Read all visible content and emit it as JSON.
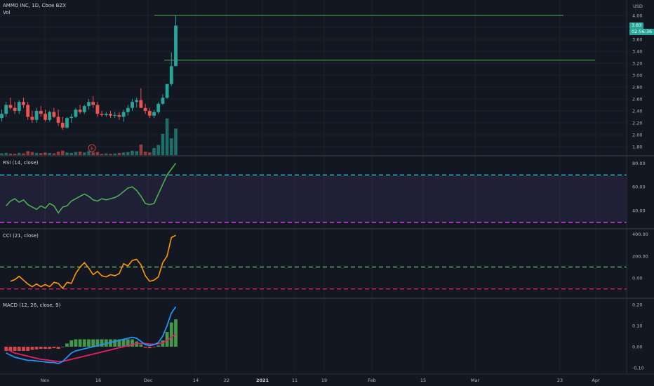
{
  "header": {
    "symbol": "AMMO INC, 1D, Cboe BZX",
    "volume_label": "Vol"
  },
  "price_axis": {
    "currency": "USD",
    "last_price": "3.83",
    "countdown": "02:56:36"
  },
  "colors": {
    "background": "#131722",
    "up": "#26a69a",
    "down": "#ef5350",
    "level_line": "#4caf50",
    "rsi": "#4caf50",
    "rsi_band": "#7e57c2",
    "cci": "#ff9800",
    "macd": "#2196f3",
    "signal": "#e91e63",
    "hist": "#4caf50"
  },
  "chart_data": [
    {
      "type": "candlestick",
      "title": "AMMO INC, 1D, Cboe BZX",
      "x": [
        "Nov",
        "16",
        "Dec",
        "14",
        "22",
        "2021",
        "11",
        "19",
        "Feb",
        "15",
        "Mar",
        "23",
        "Apr"
      ],
      "ylim": [
        1.8,
        4.1
      ],
      "y_ticks": [
        "4.00",
        "3.80",
        "3.60",
        "3.40",
        "3.20",
        "3.00",
        "2.80",
        "2.60",
        "2.40",
        "2.20",
        "2.00",
        "1.80"
      ],
      "horizontal_levels": [
        4.0,
        3.25
      ],
      "candles": [
        [
          2.28,
          2.42,
          2.22,
          2.35
        ],
        [
          2.35,
          2.55,
          2.3,
          2.5
        ],
        [
          2.5,
          2.62,
          2.42,
          2.45
        ],
        [
          2.45,
          2.55,
          2.35,
          2.4
        ],
        [
          2.4,
          2.58,
          2.35,
          2.55
        ],
        [
          2.55,
          2.62,
          2.45,
          2.5
        ],
        [
          2.5,
          2.55,
          2.25,
          2.3
        ],
        [
          2.3,
          2.4,
          2.2,
          2.25
        ],
        [
          2.25,
          2.45,
          2.2,
          2.4
        ],
        [
          2.4,
          2.48,
          2.3,
          2.35
        ],
        [
          2.35,
          2.42,
          2.22,
          2.25
        ],
        [
          2.25,
          2.4,
          2.22,
          2.38
        ],
        [
          2.38,
          2.45,
          2.28,
          2.3
        ],
        [
          2.3,
          2.42,
          2.15,
          2.2
        ],
        [
          2.2,
          2.3,
          2.08,
          2.12
        ],
        [
          2.12,
          2.3,
          2.1,
          2.28
        ],
        [
          2.28,
          2.35,
          2.2,
          2.3
        ],
        [
          2.3,
          2.45,
          2.28,
          2.42
        ],
        [
          2.42,
          2.5,
          2.35,
          2.38
        ],
        [
          2.38,
          2.5,
          2.35,
          2.48
        ],
        [
          2.48,
          2.6,
          2.42,
          2.55
        ],
        [
          2.55,
          2.65,
          2.45,
          2.5
        ],
        [
          2.5,
          2.55,
          2.3,
          2.35
        ],
        [
          2.35,
          2.4,
          2.3,
          2.33
        ],
        [
          2.33,
          2.38,
          2.3,
          2.35
        ],
        [
          2.35,
          2.4,
          2.28,
          2.32
        ],
        [
          2.32,
          2.38,
          2.28,
          2.33
        ],
        [
          2.33,
          2.38,
          2.25,
          2.3
        ],
        [
          2.3,
          2.42,
          2.22,
          2.38
        ],
        [
          2.38,
          2.5,
          2.32,
          2.45
        ],
        [
          2.45,
          2.6,
          2.4,
          2.55
        ],
        [
          2.55,
          2.62,
          2.45,
          2.58
        ],
        [
          2.58,
          2.78,
          2.45,
          2.45
        ],
        [
          2.45,
          2.52,
          2.35,
          2.4
        ],
        [
          2.4,
          2.45,
          2.28,
          2.32
        ],
        [
          2.32,
          2.42,
          2.28,
          2.38
        ],
        [
          2.38,
          2.55,
          2.35,
          2.52
        ],
        [
          2.52,
          2.68,
          2.5,
          2.62
        ],
        [
          2.62,
          2.85,
          2.6,
          2.85
        ],
        [
          2.85,
          3.38,
          2.82,
          3.15
        ],
        [
          3.15,
          4.0,
          3.2,
          3.83
        ]
      ]
    },
    {
      "type": "bar",
      "title": "Vol",
      "values": [
        0.4,
        0.5,
        0.35,
        0.3,
        0.5,
        0.4,
        0.9,
        0.7,
        0.5,
        0.45,
        0.6,
        0.5,
        0.4,
        0.8,
        1.0,
        0.6,
        0.5,
        0.7,
        0.8,
        0.6,
        0.9,
        0.6,
        0.7,
        0.3,
        0.4,
        0.3,
        0.35,
        0.5,
        0.6,
        0.7,
        1.0,
        0.9,
        2.4,
        0.8,
        0.6,
        1.6,
        2.3,
        4.8,
        8.3,
        3.8,
        6.0
      ]
    },
    {
      "type": "line",
      "title": "RSI (14, close)",
      "y_ticks": [
        "80.00",
        "60.00",
        "40.00"
      ],
      "ylim": [
        27,
        85
      ],
      "bands": [
        70,
        30
      ],
      "values": [
        44,
        48,
        50,
        47,
        49,
        45,
        43,
        41,
        44,
        42,
        46,
        44,
        38,
        43,
        44,
        48,
        50,
        52,
        54,
        52,
        49,
        48,
        50,
        49,
        50,
        51,
        53,
        56,
        59,
        60,
        57,
        52,
        46,
        45,
        46,
        54,
        62,
        70,
        75,
        80
      ]
    },
    {
      "type": "line",
      "title": "CCI (21, close)",
      "y_ticks": [
        "400.00",
        "200.00",
        "0.00"
      ],
      "ylim": [
        -160,
        430
      ],
      "bands": [
        100,
        -100
      ],
      "values": [
        -30,
        -15,
        15,
        -20,
        -55,
        -80,
        -55,
        -80,
        -60,
        -80,
        -40,
        -50,
        -95,
        -40,
        -50,
        40,
        100,
        140,
        90,
        30,
        60,
        20,
        10,
        30,
        20,
        40,
        130,
        110,
        160,
        170,
        120,
        20,
        -30,
        -20,
        10,
        140,
        200,
        370,
        390
      ]
    },
    {
      "type": "line",
      "title": "MACD (12, 26, close, 9)",
      "y_ticks": [
        "0.20",
        "0.10",
        "0.00",
        "-0.10"
      ],
      "ylim": [
        -0.12,
        0.22
      ],
      "series": [
        {
          "values": [
            -0.03,
            -0.04,
            -0.05,
            -0.055,
            -0.06,
            -0.065,
            -0.065,
            -0.068,
            -0.07,
            -0.072,
            -0.075,
            -0.075,
            -0.08,
            -0.07,
            -0.05,
            -0.03,
            -0.02,
            -0.015,
            -0.01,
            -0.005,
            0.0,
            0.005,
            0.01,
            0.015,
            0.02,
            0.025,
            0.03,
            0.035,
            0.04,
            0.045,
            0.04,
            0.025,
            0.01,
            0.005,
            0.01,
            0.02,
            0.05,
            0.1,
            0.16,
            0.19
          ]
        },
        {
          "values": [
            -0.01,
            -0.02,
            -0.03,
            -0.035,
            -0.04,
            -0.045,
            -0.05,
            -0.055,
            -0.06,
            -0.062,
            -0.065,
            -0.068,
            -0.07,
            -0.07,
            -0.065,
            -0.06,
            -0.055,
            -0.05,
            -0.045,
            -0.04,
            -0.035,
            -0.03,
            -0.025,
            -0.02,
            -0.015,
            -0.01,
            -0.005,
            0.0,
            0.005,
            0.01,
            0.015,
            0.015,
            0.015,
            0.012,
            0.012,
            0.014,
            0.02,
            0.03,
            0.045,
            0.06
          ]
        },
        {
          "values": [
            -0.02,
            -0.02,
            -0.02,
            -0.02,
            -0.02,
            -0.02,
            -0.015,
            -0.013,
            -0.01,
            -0.01,
            -0.01,
            -0.007,
            -0.01,
            0.0,
            0.015,
            0.03,
            0.035,
            0.035,
            0.035,
            0.035,
            0.035,
            0.035,
            0.035,
            0.035,
            0.035,
            0.035,
            0.035,
            0.035,
            0.035,
            0.035,
            0.025,
            0.01,
            -0.005,
            -0.007,
            -0.002,
            0.006,
            0.03,
            0.07,
            0.115,
            0.13
          ]
        }
      ]
    }
  ]
}
